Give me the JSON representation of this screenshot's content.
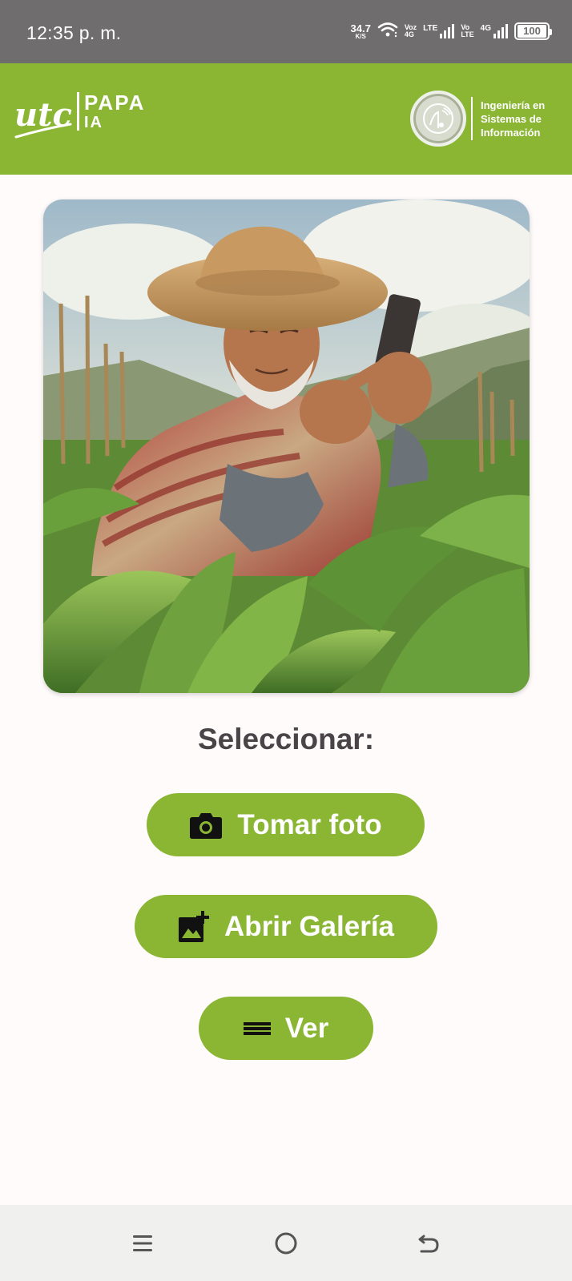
{
  "status_bar": {
    "time": "12:35 p. m.",
    "speed_value": "34.7",
    "speed_unit": "K/S",
    "net1_top": "Voz",
    "net1_bottom": "4G",
    "net1_type": "LTE",
    "net2_top": "Vo",
    "net2_bottom": "LTE",
    "net2_type": "4G",
    "battery": "100"
  },
  "header": {
    "logo_text": "utc",
    "app_name_line1": "PAPA",
    "app_name_line2": "IA",
    "dept_line1": "Ingeniería en",
    "dept_line2": "Sistemas de",
    "dept_line3": "Información"
  },
  "main": {
    "select_label": "Seleccionar:",
    "buttons": [
      {
        "label": "Tomar foto",
        "icon": "camera-icon"
      },
      {
        "label": "Abrir Galería",
        "icon": "add-photo-icon"
      },
      {
        "label": "Ver",
        "icon": "menu-lines-icon"
      }
    ]
  },
  "nav_bar": {
    "icons": [
      "menu-icon",
      "home-circle-icon",
      "back-icon"
    ]
  },
  "colors": {
    "accent": "#8ab634",
    "status_bar": "#6f6d6e",
    "title_text": "#4a4448",
    "nav_bg": "#f0f0ee"
  }
}
